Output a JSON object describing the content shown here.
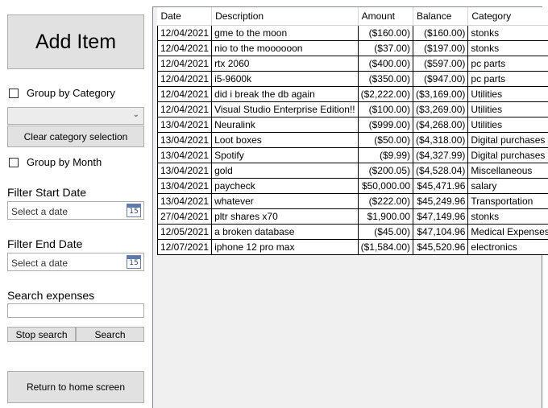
{
  "sidebar": {
    "add_item": "Add Item",
    "group_by_category": "Group by Category",
    "category_select_value": "",
    "clear_category": "Clear category selection",
    "group_by_month": "Group by Month",
    "filter_start_label": "Filter Start Date",
    "filter_start_placeholder": "Select a date",
    "filter_end_label": "Filter End Date",
    "filter_end_placeholder": "Select a date",
    "calendar_day": "15",
    "search_label": "Search expenses",
    "search_value": "",
    "stop_search": "Stop search",
    "search": "Search",
    "return_home": "Return to home screen"
  },
  "grid": {
    "columns": [
      "Date",
      "Description",
      "Amount",
      "Balance",
      "Category"
    ],
    "rows": [
      [
        "12/04/2021",
        "gme to the moon",
        "($160.00)",
        "($160.00)",
        "stonks"
      ],
      [
        "12/04/2021",
        "nio to the moooooon",
        "($37.00)",
        "($197.00)",
        "stonks"
      ],
      [
        "12/04/2021",
        "rtx 2060",
        "($400.00)",
        "($597.00)",
        "pc parts"
      ],
      [
        "12/04/2021",
        "i5-9600k",
        "($350.00)",
        "($947.00)",
        "pc parts"
      ],
      [
        "12/04/2021",
        "did i break the db again",
        "($2,222.00)",
        "($3,169.00)",
        "Utilities"
      ],
      [
        "12/04/2021",
        "Visual Studio Enterprise Edition!!",
        "($100.00)",
        "($3,269.00)",
        "Utilities"
      ],
      [
        "13/04/2021",
        "Neuralink",
        "($999.00)",
        "($4,268.00)",
        "Utilities"
      ],
      [
        "13/04/2021",
        "Loot boxes",
        "($50.00)",
        "($4,318.00)",
        "Digital purchases"
      ],
      [
        "13/04/2021",
        "Spotify",
        "($9.99)",
        "($4,327.99)",
        "Digital purchases"
      ],
      [
        "13/04/2021",
        "gold",
        "($200.05)",
        "($4,528.04)",
        "Miscellaneous"
      ],
      [
        "13/04/2021",
        "paycheck",
        "$50,000.00",
        "$45,471.96",
        "salary"
      ],
      [
        "13/04/2021",
        "whatever",
        "($222.00)",
        "$45,249.96",
        "Transportation"
      ],
      [
        "27/04/2021",
        "pltr shares x70",
        "$1,900.00",
        "$47,149.96",
        "stonks"
      ],
      [
        "12/05/2021",
        "a broken database",
        "($45.00)",
        "$47,104.96",
        "Medical Expenses"
      ],
      [
        "12/07/2021",
        "iphone 12 pro max",
        "($1,584.00)",
        "$45,520.96",
        "electronics"
      ]
    ]
  }
}
